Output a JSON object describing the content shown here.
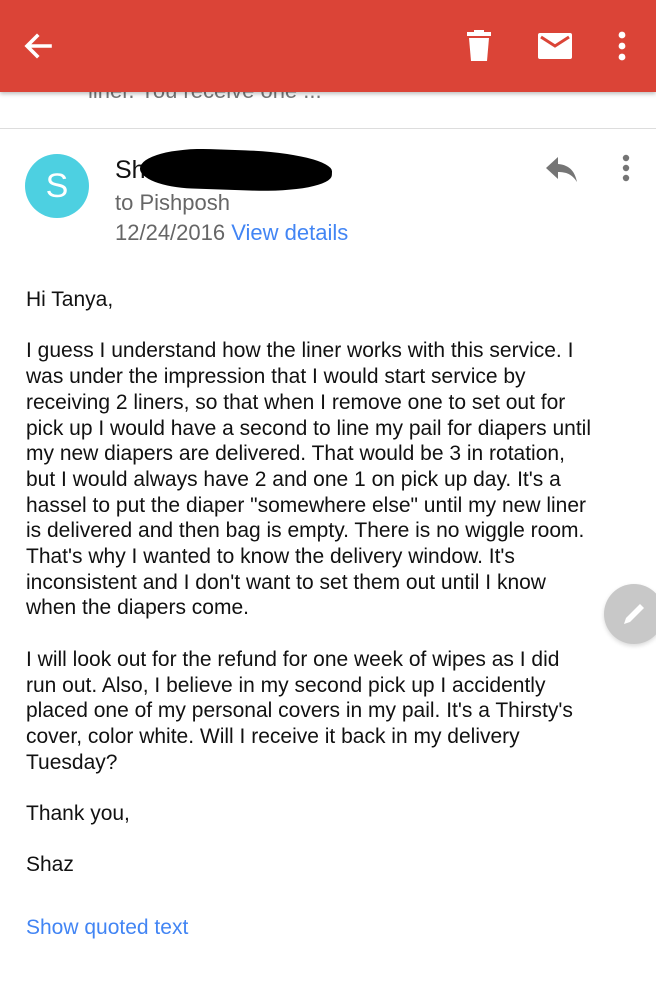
{
  "toolbar": {
    "back_icon": "arrow-back-icon",
    "delete_icon": "trash-icon",
    "mark_icon": "mail-icon",
    "more_icon": "more-vert-icon",
    "color": "#db4437"
  },
  "previous_snippet": "liner. You receive one ...",
  "message": {
    "avatar_letter": "S",
    "avatar_color": "#4dd0e1",
    "sender_visible": "Sh",
    "recipient": "to Pishposh",
    "date": "12/24/2016",
    "view_details": "View details",
    "body": [
      "Hi Tanya,",
      "I guess I understand how the liner works with this service. I\nwas under the impression that I would start service by\nreceiving 2 liners, so that when I remove one to set out for\npick up I would have a second to line my pail for diapers until\nmy new diapers are delivered.  That would be 3 in rotation,\nbut I would always have 2 and one 1 on pick up day. It's a\nhassel to put the diaper \"somewhere else\" until my new liner\nis delivered and then bag is empty. There is no wiggle room.\nThat's why I wanted to know the delivery window. It's\ninconsistent and I don't want to set them out until I know\nwhen the diapers come.",
      "I will look out for the refund for one week of wipes as I did\nrun out. Also, I believe in my second pick up I accidently\nplaced one of my personal covers in my pail. It's a Thirsty's\ncover, color white. Will I receive it back in my delivery\nTuesday?",
      "Thank you,",
      "Shaz"
    ],
    "show_quoted": "Show quoted text"
  },
  "fab_icon": "pencil-icon",
  "link_color": "#4285f4"
}
